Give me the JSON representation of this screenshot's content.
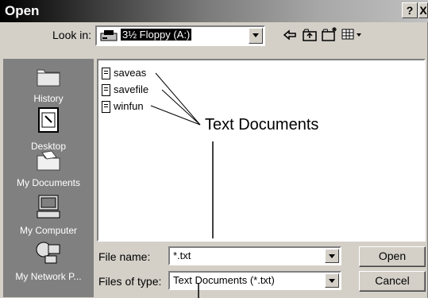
{
  "window": {
    "title": "Open",
    "help_label": "?",
    "close_label": "X"
  },
  "lookin": {
    "label": "Look in:",
    "value": "3½ Floppy (A:)"
  },
  "toolbar": {
    "icons": [
      "back-arrow-icon",
      "up-folder-icon",
      "new-folder-icon",
      "view-menu-icon"
    ]
  },
  "places": [
    {
      "label": "History",
      "icon": "history-folder-icon"
    },
    {
      "label": "Desktop",
      "icon": "desktop-icon"
    },
    {
      "label": "My Documents",
      "icon": "my-documents-icon"
    },
    {
      "label": "My Computer",
      "icon": "my-computer-icon"
    },
    {
      "label": "My Network P...",
      "icon": "network-places-icon"
    }
  ],
  "files": [
    {
      "name": "saveas"
    },
    {
      "name": "savefile"
    },
    {
      "name": "winfun"
    }
  ],
  "callout": {
    "text": "Text Documents"
  },
  "filename": {
    "label": "File name:",
    "value": "*.txt"
  },
  "filetype": {
    "label": "Files of type:",
    "value": "Text Documents (*.txt)"
  },
  "buttons": {
    "open": "Open",
    "cancel": "Cancel"
  }
}
